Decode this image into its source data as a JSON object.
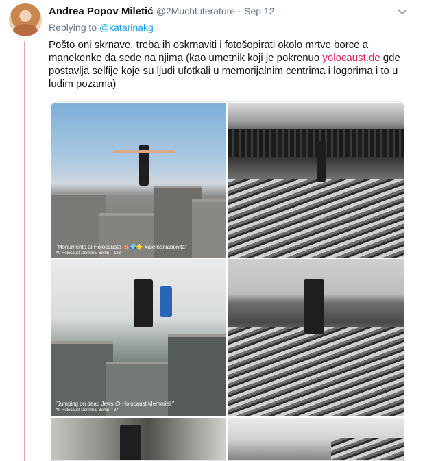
{
  "tweet": {
    "author_name": "Andrea Popov Miletić",
    "handle": "@2MuchLiterature",
    "separator": "·",
    "date": "Sep 12",
    "reply_prefix": "Replying to",
    "reply_to": "@katarinakg",
    "text_before_link": "Pošto oni skrnave, treba ih oskrnaviti i fotošopirati okolo mrtve borce a manekenke da sede na njima (kao umetnik koji je pokrenuo ",
    "link_text": "yolocaust.de",
    "text_after_link": " gde postavlja selfije koje su ljudi ufotkali u memorijalnim centrima i logorima i to u ludim pozama)"
  },
  "media": {
    "photo1_caption": "\"Monumento al Holocausto 🙈🌍🌟 #alemaniabonita\"",
    "photo1_location": "At: Holocaust Denkmal Berlin",
    "photo1_likes": "123",
    "photo3_caption": "\"Jumping on dead Jews @ Holocaust Memorial.\"",
    "photo3_location": "At: Holocaust Denkmal Berlin",
    "photo3_likes": "87"
  },
  "colors": {
    "link_blue": "#1da1f2",
    "link_pink": "#e0245e",
    "thread_line": "#e9a2d0",
    "muted_text": "#657786"
  },
  "icons": [
    "avatar",
    "chevron-down-icon",
    "heart-icon"
  ]
}
